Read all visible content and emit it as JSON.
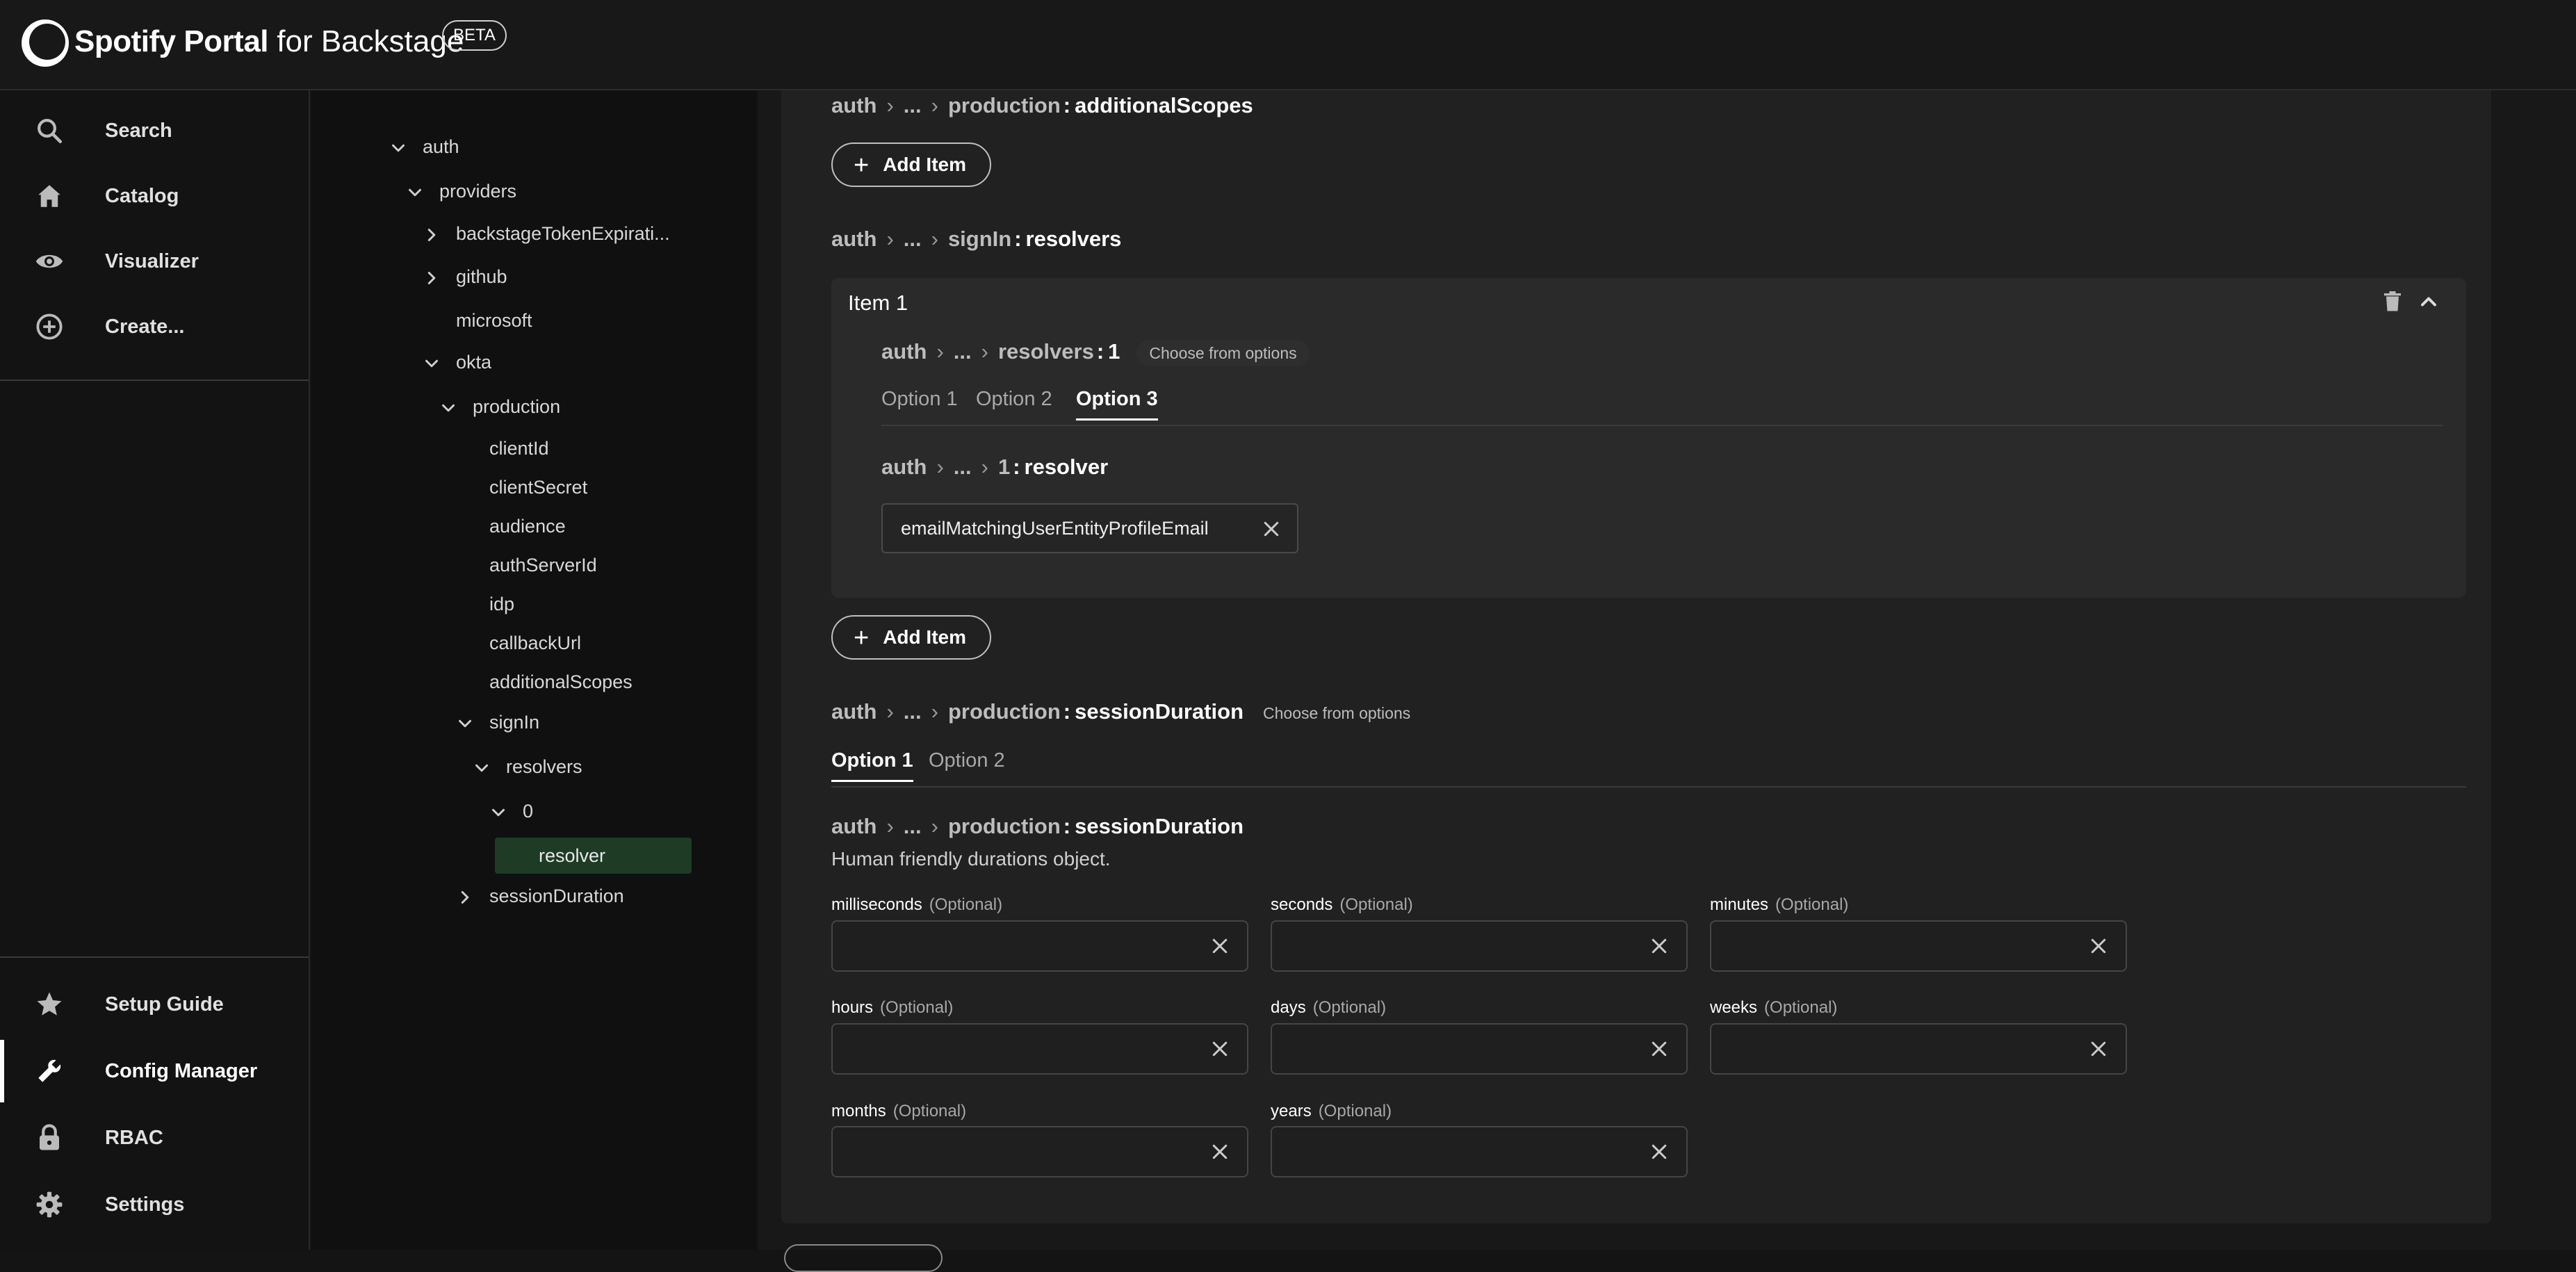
{
  "header": {
    "brand_bold": "Spotify Portal",
    "brand_rest": " for Backstage",
    "beta_badge": "BETA"
  },
  "sidebar": {
    "top_items": [
      {
        "label": "Search",
        "icon": "search-icon"
      },
      {
        "label": "Catalog",
        "icon": "home-icon"
      },
      {
        "label": "Visualizer",
        "icon": "eye-icon"
      },
      {
        "label": "Create...",
        "icon": "add-circle-icon"
      }
    ],
    "bottom_items": [
      {
        "label": "Setup Guide",
        "icon": "star-icon"
      },
      {
        "label": "Config Manager",
        "icon": "wrench-icon",
        "active": true
      },
      {
        "label": "RBAC",
        "icon": "lock-icon"
      },
      {
        "label": "Settings",
        "icon": "gear-icon"
      }
    ]
  },
  "tree": {
    "nodes": [
      {
        "label": "auth",
        "chevron": "down"
      },
      {
        "label": "providers",
        "chevron": "down"
      },
      {
        "label": "backstageTokenExpirati...",
        "chevron": "right"
      },
      {
        "label": "github",
        "chevron": "right"
      },
      {
        "label": "microsoft",
        "chevron": "none"
      },
      {
        "label": "okta",
        "chevron": "down"
      },
      {
        "label": "production",
        "chevron": "down"
      },
      {
        "label": "clientId",
        "chevron": "none"
      },
      {
        "label": "clientSecret",
        "chevron": "none"
      },
      {
        "label": "audience",
        "chevron": "none"
      },
      {
        "label": "authServerId",
        "chevron": "none"
      },
      {
        "label": "idp",
        "chevron": "none"
      },
      {
        "label": "callbackUrl",
        "chevron": "none"
      },
      {
        "label": "additionalScopes",
        "chevron": "none"
      },
      {
        "label": "signIn",
        "chevron": "down"
      },
      {
        "label": "resolvers",
        "chevron": "down"
      },
      {
        "label": "0",
        "chevron": "down"
      },
      {
        "label": "resolver",
        "chevron": "none",
        "selected": true
      },
      {
        "label": "sessionDuration",
        "chevron": "right"
      }
    ]
  },
  "main": {
    "crumb_root": "auth",
    "ellipsis": "...",
    "additional_scopes": {
      "parent": "production",
      "key": "additionalScopes"
    },
    "add_item_label": "Add Item",
    "resolvers": {
      "parent": "signIn",
      "key": "resolvers"
    },
    "item": {
      "title": "Item 1",
      "path_parent": "resolvers",
      "path_key": "1",
      "choose_hint": "Choose from options",
      "tabs": [
        "Option 1",
        "Option 2",
        "Option 3"
      ],
      "active_tab": 2,
      "resolver_path": {
        "parent": "1",
        "key": "resolver"
      },
      "resolver_value": "emailMatchingUserEntityProfileEmail"
    },
    "session": {
      "parent": "production",
      "key": "sessionDuration",
      "choose_hint": "Choose from options",
      "tabs": [
        "Option 1",
        "Option 2"
      ],
      "active_tab": 0,
      "description": "Human friendly durations object.",
      "optional_label": "(Optional)",
      "fields": [
        {
          "name": "milliseconds",
          "value": ""
        },
        {
          "name": "seconds",
          "value": ""
        },
        {
          "name": "minutes",
          "value": ""
        },
        {
          "name": "hours",
          "value": ""
        },
        {
          "name": "days",
          "value": ""
        },
        {
          "name": "weeks",
          "value": ""
        },
        {
          "name": "months",
          "value": ""
        },
        {
          "name": "years",
          "value": ""
        }
      ]
    }
  }
}
